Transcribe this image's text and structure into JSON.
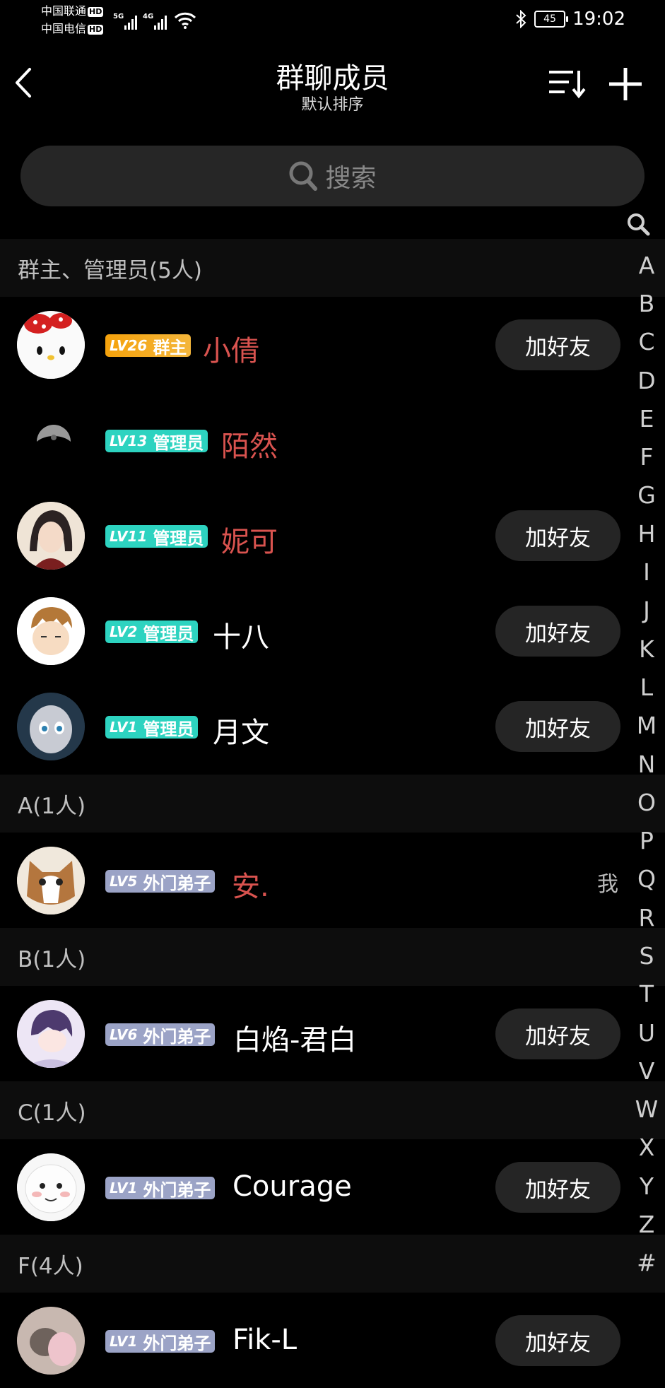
{
  "status_bar": {
    "carrier1": "中国联通",
    "carrier2": "中国电信",
    "hd": "HD",
    "net1": "5G",
    "net2": "4G",
    "battery": "45",
    "time": "19:02"
  },
  "header": {
    "title": "群聊成员",
    "subtitle": "默认排序"
  },
  "search": {
    "placeholder": "搜索"
  },
  "sections": {
    "admins": "群主、管理员(5人)",
    "a": "A(1人)",
    "b": "B(1人)",
    "c": "C(1人)",
    "f": "F(4人)"
  },
  "add_friend_label": "加好友",
  "members": [
    {
      "lv": "LV26",
      "role": "群主",
      "name": "小倩"
    },
    {
      "lv": "LV13",
      "role": "管理员",
      "name": "陌然"
    },
    {
      "lv": "LV11",
      "role": "管理员",
      "name": "妮可"
    },
    {
      "lv": "LV2",
      "role": "管理员",
      "name": "十八"
    },
    {
      "lv": "LV1",
      "role": "管理员",
      "name": "月文"
    },
    {
      "lv": "LV5",
      "role": "外门弟子",
      "name": "安.",
      "me": "我"
    },
    {
      "lv": "LV6",
      "role": "外门弟子",
      "name": "白焰-君白"
    },
    {
      "lv": "LV1",
      "role": "外门弟子",
      "name": "Courage"
    },
    {
      "lv": "LV1",
      "role": "外门弟子",
      "name": "Fik-L"
    }
  ],
  "index_letters": [
    "A",
    "B",
    "C",
    "D",
    "E",
    "F",
    "G",
    "H",
    "I",
    "J",
    "K",
    "L",
    "M",
    "N",
    "O",
    "P",
    "Q",
    "R",
    "S",
    "T",
    "U",
    "V",
    "W",
    "X",
    "Y",
    "Z",
    "#"
  ],
  "colors": {
    "owner_badge": "#f5a20c",
    "admin_badge": "#2dd3c0",
    "disciple_badge": "#9ba3c6",
    "highlight_name": "#d9534f"
  }
}
